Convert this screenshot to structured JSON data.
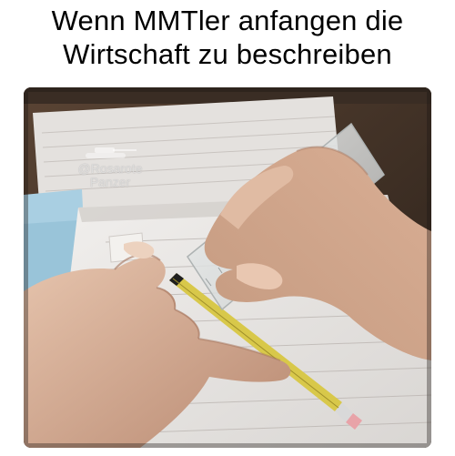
{
  "caption": {
    "line1": "Wenn MMTler anfangen die",
    "line2": "Wirtschaft zu beschreiben"
  },
  "watermark": {
    "handle": "@Rosarote",
    "handle2": "Panzer",
    "icon": "tank-icon"
  },
  "colors": {
    "background": "#ffffff",
    "caption_text": "#000000",
    "pencil": "#d8c84a",
    "paper": "#e9e6e3"
  }
}
